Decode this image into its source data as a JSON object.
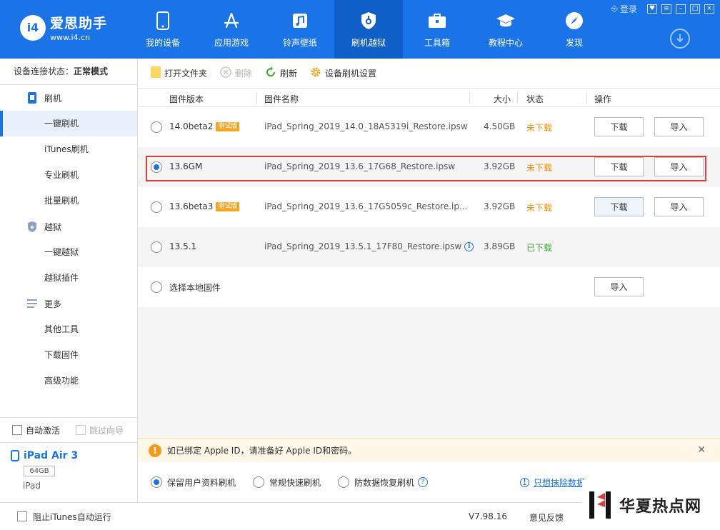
{
  "app": {
    "name": "爱思助手",
    "url": "www.i4.cn",
    "badge": "i4"
  },
  "window": {
    "login": "登录"
  },
  "nav": [
    {
      "label": "我的设备",
      "icon": "phone-icon"
    },
    {
      "label": "应用游戏",
      "icon": "app-store-icon"
    },
    {
      "label": "铃声壁纸",
      "icon": "music-icon"
    },
    {
      "label": "刷机越狱",
      "icon": "shield-lock-icon",
      "active": true
    },
    {
      "label": "工具箱",
      "icon": "toolbox-icon"
    },
    {
      "label": "教程中心",
      "icon": "graduation-cap-icon"
    },
    {
      "label": "发现",
      "icon": "compass-icon"
    }
  ],
  "sidebar": {
    "status_label": "设备连接状态：",
    "status_value": "正常模式",
    "section_flash": "刷机",
    "flash_items": [
      "一键刷机",
      "iTunes刷机",
      "专业刷机",
      "批量刷机"
    ],
    "section_jailbreak": "越狱",
    "jailbreak_items": [
      "一键越狱",
      "越狱插件"
    ],
    "section_more": "更多",
    "more_items": [
      "其他工具",
      "下载固件",
      "高级功能"
    ],
    "auto_activate": "自动激活",
    "skip_guide": "跳过向导"
  },
  "device": {
    "name": "iPad Air 3",
    "capacity": "64GB",
    "type": "iPad"
  },
  "toolbar": {
    "open_folder": "打开文件夹",
    "delete": "删除",
    "refresh": "刷新",
    "settings": "设备刷机设置"
  },
  "table": {
    "headers": {
      "version": "固件版本",
      "name": "固件名称",
      "size": "大小",
      "status": "状态",
      "action": "操作"
    },
    "beta_tag": "测试版",
    "download_label": "下载",
    "import_label": "导入",
    "rows": [
      {
        "version": "14.0beta2",
        "name": "iPad_Spring_2019_14.0_18A5319i_Restore.ipsw",
        "size": "4.50GB",
        "status": "未下载"
      },
      {
        "version": "13.6GM",
        "name": "iPad_Spring_2019_13.6_17G68_Restore.ipsw",
        "size": "3.92GB",
        "status": "未下载"
      },
      {
        "version": "13.6beta3",
        "name": "iPad_Spring_2019_13.6_17G5059c_Restore.ip...",
        "size": "3.92GB",
        "status": "未下载"
      },
      {
        "version": "13.5.1",
        "name": "iPad_Spring_2019_13.5.1_17F80_Restore.ipsw",
        "size": "3.89GB",
        "status": "已下载"
      }
    ],
    "local_row": "选择本地固件"
  },
  "notice": {
    "text": "如已绑定 Apple ID，请准备好 Apple ID和密码。"
  },
  "modes": {
    "keep_data": "保留用户资料刷机",
    "quick": "常规快速刷机",
    "recovery": "防数据恢复刷机",
    "erase_link": "只想抹除数据"
  },
  "statusbar": {
    "block_itunes": "阻止iTunes自动运行",
    "version": "V7.98.16",
    "feedback": "意见反馈"
  },
  "watermark": {
    "text": "华夏热点网"
  },
  "colors": {
    "brand": "#1a74e8",
    "not_downloaded": "#f08c00",
    "downloaded": "#3aa832",
    "highlight": "#e23b3b"
  }
}
